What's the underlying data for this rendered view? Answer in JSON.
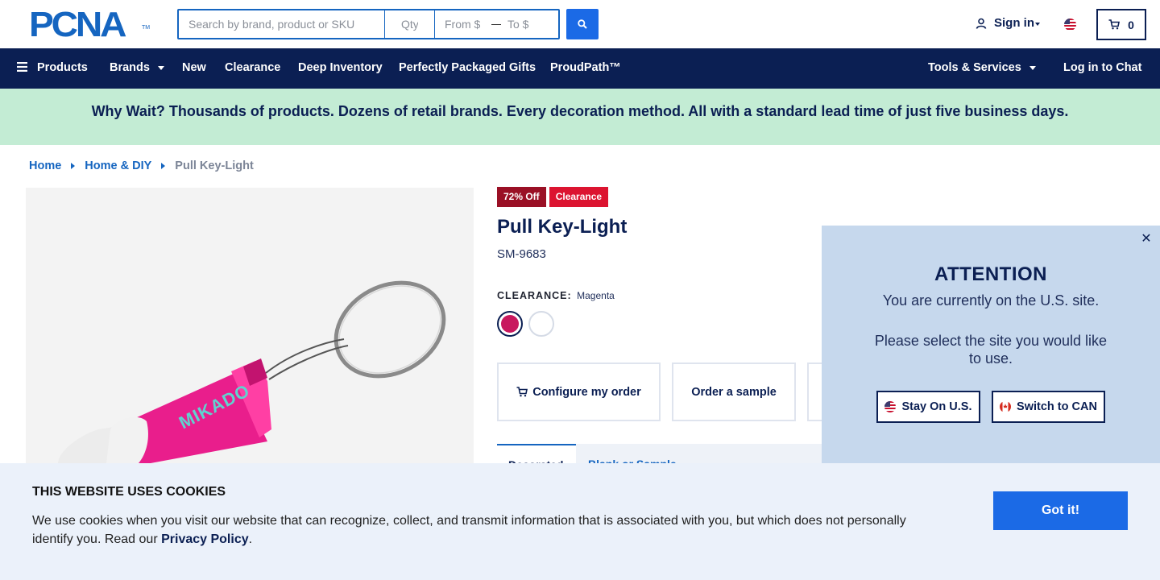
{
  "header": {
    "logo_text": "PCNA",
    "logo_tm": "TM",
    "search_placeholder": "Search by brand, product or SKU",
    "qty_placeholder": "Qty",
    "price_from_placeholder": "From $",
    "price_to_placeholder": "To $",
    "sign_in_label": "Sign in",
    "cart_count": "0"
  },
  "nav": {
    "products": "Products",
    "brands": "Brands",
    "new": "New",
    "clearance": "Clearance",
    "deep_inventory": "Deep Inventory",
    "gifts": "Perfectly Packaged Gifts",
    "proudpath": "ProudPath™",
    "tools": "Tools & Services",
    "chat": "Log in to Chat"
  },
  "banner": {
    "text": "Why Wait? Thousands of products. Dozens of retail brands. Every decoration method. All with a standard lead time of just five business days."
  },
  "breadcrumb": {
    "home": "Home",
    "category": "Home & DIY",
    "current": "Pull Key-Light"
  },
  "product": {
    "image_brand": "MIKADO",
    "badge_discount": "72% Off",
    "badge_status": "Clearance",
    "title": "Pull Key-Light",
    "sku": "SM-9683",
    "color_label": "CLEARANCE:",
    "color_value": "Magenta",
    "swatch_colors": [
      "#c8185e",
      "#ffffff"
    ],
    "actions": {
      "configure": "Configure my order",
      "sample": "Order a sample"
    },
    "tabs": {
      "active": "Decorated",
      "second": "Blank or Sample"
    }
  },
  "attention_popup": {
    "close_glyph": "✕",
    "title": "ATTENTION",
    "line1": "You are currently on the U.S. site.",
    "line2": "Please select the site you would like to use.",
    "stay_button": "Stay On U.S.",
    "switch_button": "Switch to CAN"
  },
  "cookie": {
    "title": "THIS WEBSITE USES COOKIES",
    "text": "We use cookies when you visit our website that can recognize, collect, and transmit information that is associated with you, but which does not personally identify you. Read our ",
    "link": "Privacy Policy",
    "text_end": ".",
    "button": "Got it!"
  },
  "colors": {
    "brand_blue": "#1565c0",
    "navy": "#0b1f53",
    "banner_green": "#c3ecd4",
    "badge_dark_red": "#9a1025",
    "badge_red": "#dc1430",
    "popup_bg": "#c6d8ed",
    "cookie_bg": "#ebf1fa",
    "button_blue": "#1b6ae6"
  },
  "icons": [
    "user-icon",
    "us-flag-icon",
    "cart-icon",
    "search-icon",
    "hamburger-icon",
    "close-icon",
    "canada-flag-icon"
  ]
}
